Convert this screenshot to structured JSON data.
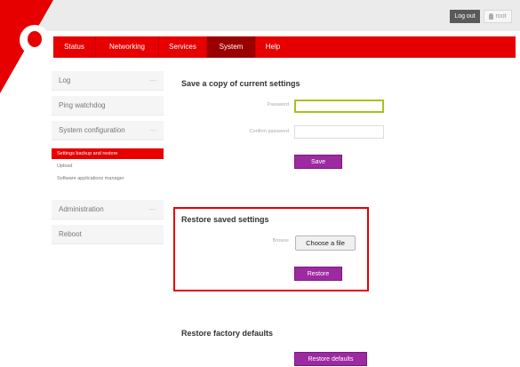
{
  "header": {
    "logout_label": "Log out",
    "user_label": "root"
  },
  "nav": {
    "items": [
      {
        "label": "Status"
      },
      {
        "label": "Networking"
      },
      {
        "label": "Services"
      },
      {
        "label": "System",
        "active": true
      },
      {
        "label": "Help"
      }
    ]
  },
  "sidebar": {
    "items": [
      {
        "label": "Log"
      },
      {
        "label": "Ping watchdog"
      },
      {
        "label": "System configuration"
      },
      {
        "label": "Administration"
      },
      {
        "label": "Reboot"
      }
    ],
    "subitems": [
      {
        "label": "Settings backup and restore",
        "active": true
      },
      {
        "label": "Upload"
      },
      {
        "label": "Software applications manager"
      }
    ]
  },
  "save_section": {
    "title": "Save a copy of current settings",
    "password_label": "Password",
    "confirm_label": "Confirm password",
    "save_button": "Save"
  },
  "restore_section": {
    "title": "Restore saved settings",
    "browse_label": "Browse",
    "choose_file_button": "Choose a file",
    "restore_button": "Restore"
  },
  "factory_section": {
    "title": "Restore factory defaults",
    "restore_defaults_button": "Restore defaults"
  },
  "colors": {
    "brand_red": "#e60000",
    "accent_purple": "#9c2aa0",
    "focus_green": "#a9c11e"
  }
}
